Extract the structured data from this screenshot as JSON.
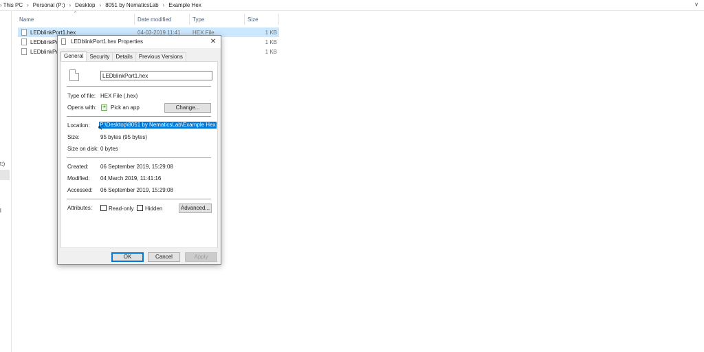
{
  "breadcrumb": {
    "lead_sep": "›",
    "items": [
      "This PC",
      "Personal (P:)",
      "Desktop",
      "8051 by NematicsLab",
      "Example Hex"
    ],
    "separator": "›",
    "dropdown": "∨"
  },
  "columns": {
    "name": "Name",
    "date_modified": "Date modified",
    "type": "Type",
    "size": "Size",
    "sort_indicator": "^"
  },
  "nav": {
    "fragment1": "t:)",
    "fragment2": "l"
  },
  "files": [
    {
      "name": "LEDblinkPort1.hex",
      "date": "04-03-2019 11:41",
      "type": "HEX File",
      "size": "1 KB",
      "selected": true
    },
    {
      "name": "LEDblinkPo",
      "date": "",
      "type": "",
      "size": "1 KB",
      "selected": false
    },
    {
      "name": "LEDblinkPo",
      "date": "",
      "type": "",
      "size": "1 KB",
      "selected": false
    }
  ],
  "dialog": {
    "title": "LEDblinkPort1.hex Properties",
    "close": "✕",
    "tabs": [
      "General",
      "Security",
      "Details",
      "Previous Versions"
    ],
    "file_name": "LEDblinkPort1.hex",
    "type_label": "Type of file:",
    "type_value": "HEX File (.hex)",
    "opens_label": "Opens with:",
    "opens_value": "Pick an app",
    "change_button": "Change...",
    "location_label": "Location:",
    "location_value": "P:\\Desktop\\8051 by NematicsLab\\Example Hex",
    "size_label": "Size:",
    "size_value": "95 bytes (95 bytes)",
    "size_disk_label": "Size on disk:",
    "size_disk_value": "0 bytes",
    "created_label": "Created:",
    "created_value": "06 September 2019, 15:29:08",
    "modified_label": "Modified:",
    "modified_value": "04 March 2019, 11:41:16",
    "accessed_label": "Accessed:",
    "accessed_value": "06 September 2019, 15:29:08",
    "attributes_label": "Attributes:",
    "readonly_label": "Read-only",
    "hidden_label": "Hidden",
    "advanced_button": "Advanced...",
    "ok_button": "OK",
    "cancel_button": "Cancel",
    "apply_button": "Apply"
  },
  "colors": {
    "selection": "#cce8ff",
    "highlight": "#0078d7"
  }
}
